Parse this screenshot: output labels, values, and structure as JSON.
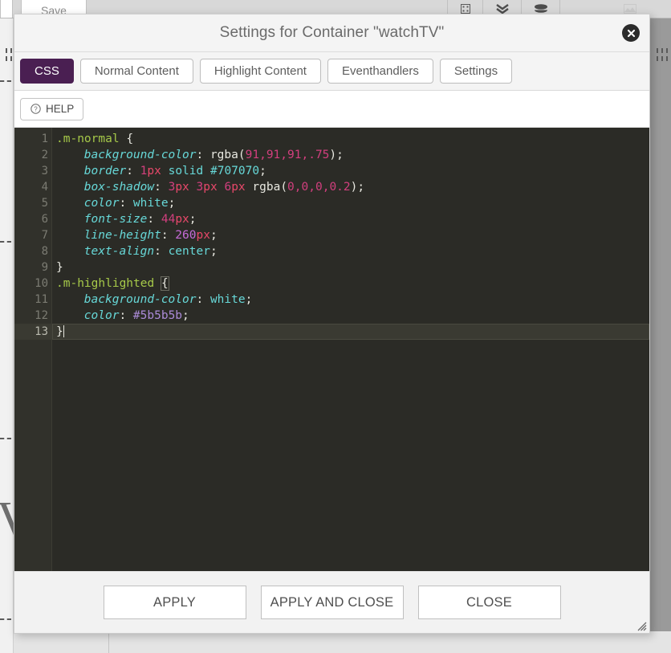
{
  "background": {
    "tab_label": "Save",
    "toolbar_icons": [
      {
        "name": "grid-icon",
        "glyph": "░"
      },
      {
        "name": "chevron-double-down-icon",
        "glyph": "»"
      },
      {
        "name": "layers-icon",
        "glyph": "☰"
      },
      {
        "name": "image-icon",
        "glyph": "▢"
      }
    ],
    "canvas_letter": "V"
  },
  "modal": {
    "title": "Settings for Container \"watchTV\"",
    "close_icon": "close-icon",
    "tabs": [
      {
        "label": "CSS",
        "active": true
      },
      {
        "label": "Normal Content",
        "active": false
      },
      {
        "label": "Highlight Content",
        "active": false
      },
      {
        "label": "Eventhandlers",
        "active": false
      },
      {
        "label": "Settings",
        "active": false
      }
    ],
    "help": {
      "label": "HELP",
      "icon": "question-circle-icon"
    },
    "footer_buttons": [
      {
        "label": "APPLY",
        "name": "apply-button"
      },
      {
        "label": "APPLY AND CLOSE",
        "name": "apply-and-close-button"
      },
      {
        "label": "CLOSE",
        "name": "close-button"
      }
    ],
    "resize_grip": "resize-grip-icon"
  },
  "editor": {
    "line_numbers": [
      "1",
      "2",
      "3",
      "4",
      "5",
      "6",
      "7",
      "8",
      "9",
      "10",
      "11",
      "12",
      "13"
    ],
    "fold_lines": [
      1,
      10
    ],
    "active_line": 13,
    "lines": [
      {
        "n": 1,
        "text": ".m-normal {"
      },
      {
        "n": 2,
        "text": "    background-color: rgba(91,91,91,.75);"
      },
      {
        "n": 3,
        "text": "    border: 1px solid #707070;"
      },
      {
        "n": 4,
        "text": "    box-shadow: 3px 3px 6px rgba(0,0,0,0.2);"
      },
      {
        "n": 5,
        "text": "    color: white;"
      },
      {
        "n": 6,
        "text": "    font-size: 44px;"
      },
      {
        "n": 7,
        "text": "    line-height: 260px;"
      },
      {
        "n": 8,
        "text": "    text-align: center;"
      },
      {
        "n": 9,
        "text": "}"
      },
      {
        "n": 10,
        "text": ".m-highlighted {"
      },
      {
        "n": 11,
        "text": "    background-color: white;"
      },
      {
        "n": 12,
        "text": "    color: #5b5b5b;"
      },
      {
        "n": 13,
        "text": "}"
      }
    ],
    "tokens": {
      "sel1": ".m-normal",
      "sel2": ".m-highlighted",
      "brace_open": "{",
      "brace_close": "}",
      "p_background_color": "background-color",
      "p_border": "border",
      "p_box_shadow": "box-shadow",
      "p_color": "color",
      "p_font_size": "font-size",
      "p_line_height": "line-height",
      "p_text_align": "text-align",
      "colon": ":",
      "semicolon": ";",
      "rgba_fn": "rgba",
      "paren_open": "(",
      "paren_close": ")",
      "v_91": "91",
      "v_dot75": ".75",
      "v_1": "1",
      "v_px": "px",
      "v_solid": "solid",
      "v_707070": "#707070",
      "v_3": "3",
      "v_6": "6",
      "v_0": "0",
      "v_02": "0.2",
      "v_white": "white",
      "v_44": "44",
      "v_260": "260",
      "v_center": "center",
      "v_5b5b5b": "#5b5b5b",
      "comma": ","
    },
    "colors": {
      "bg": "#2b2b26",
      "gutter_bg": "#31312b",
      "active_line_bg": "#3a3a32",
      "selector": "#a6c949",
      "property": "#67d8d8",
      "value": "#67d8d8",
      "number": "#d23f7e",
      "unit": "#e8486a",
      "hex_purple": "#ab8bd8",
      "punctuation": "#e8e8e0"
    }
  },
  "theme": {
    "accent": "#4a1f52",
    "modal_bg": "#f4f4f4",
    "footer_bg": "#f2f2f2"
  }
}
